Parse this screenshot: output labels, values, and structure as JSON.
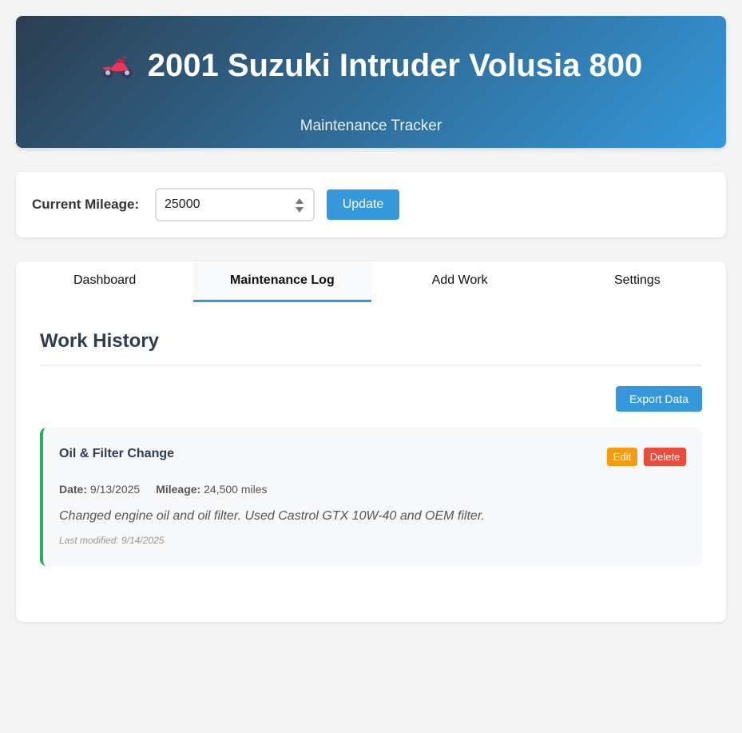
{
  "header": {
    "title": "2001 Suzuki Intruder Volusia 800",
    "subtitle": "Maintenance Tracker",
    "icon": "motorcycle-icon"
  },
  "mileage": {
    "label": "Current Mileage:",
    "value": "25000",
    "update_label": "Update"
  },
  "tabs": [
    {
      "label": "Dashboard",
      "active": false
    },
    {
      "label": "Maintenance Log",
      "active": true
    },
    {
      "label": "Add Work",
      "active": false
    },
    {
      "label": "Settings",
      "active": false
    }
  ],
  "log": {
    "title": "Work History",
    "export_label": "Export Data",
    "entries": [
      {
        "title": "Oil & Filter Change",
        "edit_label": "Edit",
        "delete_label": "Delete",
        "date_label": "Date:",
        "date": "9/13/2025",
        "mileage_label": "Mileage:",
        "mileage": "24,500 miles",
        "description": "Changed engine oil and oil filter. Used Castrol GTX 10W-40 and OEM filter.",
        "last_modified": "Last modified: 9/14/2025"
      }
    ]
  },
  "colors": {
    "accent": "#3498db",
    "header_dark": "#2c3e50",
    "edit": "#f39c12",
    "delete": "#e74c3c",
    "entry_border": "#27ae60"
  }
}
